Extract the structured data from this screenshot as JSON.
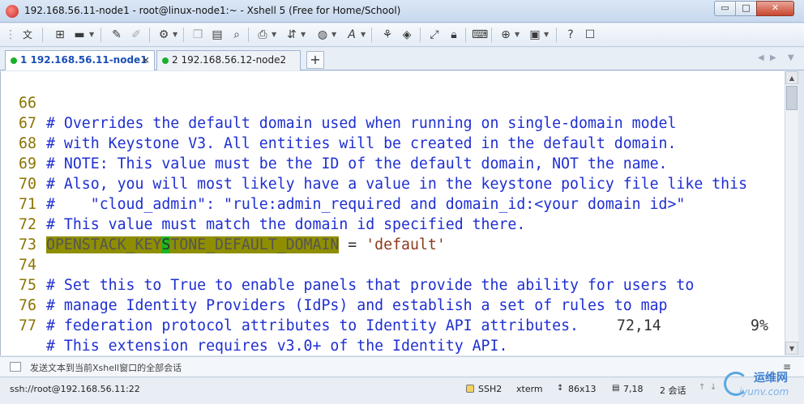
{
  "window": {
    "title": "192.168.56.11-node1 - root@linux-node1:~ - Xshell 5 (Free for Home/School)",
    "minimize_glyph": "▭",
    "maximize_glyph": "□",
    "close_glyph": "✕"
  },
  "toolbar": {
    "wen_label": "文",
    "icons": [
      "new-session-icon",
      "open-folder-icon",
      "reconnect-icon",
      "disconnect-icon",
      "properties-icon",
      "copy-icon",
      "paste-icon",
      "find-icon",
      "print-icon",
      "transfer-icon",
      "globe-icon",
      "font-icon",
      "xftp-icon",
      "xmanager-icon",
      "fullscreen-icon",
      "lock-icon",
      "keyboard-icon",
      "add-tab-icon",
      "layout-icon",
      "help-icon",
      "comment-icon"
    ]
  },
  "tabs": [
    {
      "label": "1 192.168.56.11-node1",
      "active": true
    },
    {
      "label": "2 192.168.56.12-node2",
      "active": false
    }
  ],
  "terminal": {
    "lines": [
      {
        "num": "66",
        "text": "# Overrides the default domain used when running on single-domain model"
      },
      {
        "num": "67",
        "text": "# with Keystone V3. All entities will be created in the default domain."
      },
      {
        "num": "68",
        "text": "# NOTE: This value must be the ID of the default domain, NOT the name."
      },
      {
        "num": "69",
        "text": "# Also, you will most likely have a value in the keystone policy file like this"
      },
      {
        "num": "70",
        "text": "#    \"cloud_admin\": \"rule:admin_required and domain_id:<your domain id>\""
      },
      {
        "num": "71",
        "text": "# This value must match the domain id specified there."
      },
      {
        "num": "72",
        "hl_before": "OPENSTACK_KEY",
        "hl_cursor": "S",
        "hl_after": "TONE_DEFAULT_DOMAIN",
        "rest_op": " = ",
        "rest_str": "'default'"
      },
      {
        "num": "73",
        "text": ""
      },
      {
        "num": "74",
        "text": "# Set this to True to enable panels that provide the ability for users to"
      },
      {
        "num": "75",
        "text": "# manage Identity Providers (IdPs) and establish a set of rules to map"
      },
      {
        "num": "76",
        "text": "# federation protocol attributes to Identity API attributes."
      },
      {
        "num": "77",
        "text": "# This extension requires v3.0+ of the Identity API."
      }
    ],
    "cursor_position": "72,14",
    "percent": "9%"
  },
  "compose": {
    "placeholder": "发送文本到当前Xshell窗口的全部会话",
    "menu_glyph": "≡"
  },
  "statusbar": {
    "connection": "ssh://root@192.168.56.11:22",
    "protocol": "SSH2",
    "terminal_type": "xterm",
    "size": "86x13",
    "cursor": "7,18",
    "sessions": "2 会话"
  },
  "watermark": {
    "cn": "运维网",
    "en": "iyunv.com"
  }
}
